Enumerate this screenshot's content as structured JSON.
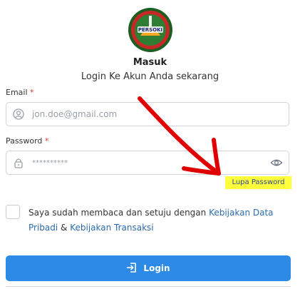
{
  "header": {
    "logo_text": "PERSOKI",
    "title": "Masuk",
    "subtitle": "Login Ke Akun Anda sekarang"
  },
  "email": {
    "label": "Email",
    "required_mark": "*",
    "placeholder": "jon.doe@gmail.com",
    "icon": "user-circle-icon"
  },
  "password": {
    "label": "Password",
    "required_mark": "*",
    "placeholder": "**********",
    "icon": "lock-icon",
    "toggle_icon": "eye-icon",
    "forgot_label": "Lupa Password"
  },
  "agreement": {
    "checked": false,
    "text_before": "Saya sudah membaca dan setuju dengan ",
    "link1": "Kebijakan Data Pribadi",
    "joiner": " & ",
    "link2": "Kebijakan Transaksi"
  },
  "login_button": {
    "label": "Login",
    "icon": "login-arrow-icon"
  },
  "colors": {
    "primary": "#2d8ae6",
    "link": "#2b6cb0",
    "highlight": "#ffff3c",
    "annotation": "#e00000",
    "required": "#e53935"
  }
}
